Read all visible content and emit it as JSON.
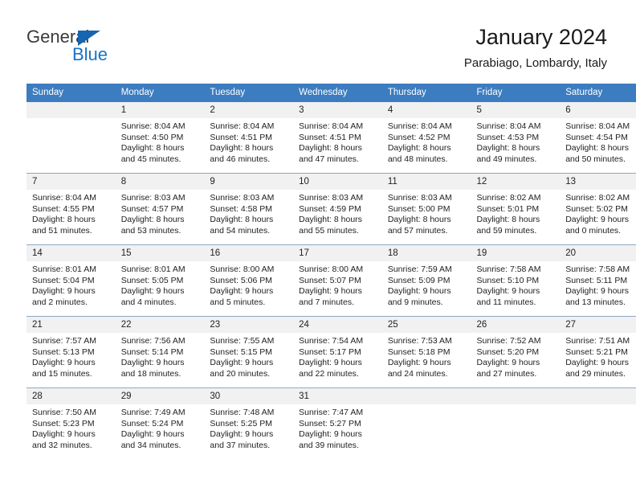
{
  "brand": {
    "name_part1": "General",
    "name_part2": "Blue",
    "color_dark": "#3b3b3b",
    "color_blue": "#1774c4"
  },
  "header": {
    "title": "January 2024",
    "subtitle": "Parabiago, Lombardy, Italy",
    "header_bg": "#3c7cc0"
  },
  "weekdays": [
    "Sunday",
    "Monday",
    "Tuesday",
    "Wednesday",
    "Thursday",
    "Friday",
    "Saturday"
  ],
  "weeks": [
    [
      {
        "day": "",
        "sunrise": "",
        "sunset": "",
        "daylight1": "",
        "daylight2": ""
      },
      {
        "day": "1",
        "sunrise": "Sunrise: 8:04 AM",
        "sunset": "Sunset: 4:50 PM",
        "daylight1": "Daylight: 8 hours",
        "daylight2": "and 45 minutes."
      },
      {
        "day": "2",
        "sunrise": "Sunrise: 8:04 AM",
        "sunset": "Sunset: 4:51 PM",
        "daylight1": "Daylight: 8 hours",
        "daylight2": "and 46 minutes."
      },
      {
        "day": "3",
        "sunrise": "Sunrise: 8:04 AM",
        "sunset": "Sunset: 4:51 PM",
        "daylight1": "Daylight: 8 hours",
        "daylight2": "and 47 minutes."
      },
      {
        "day": "4",
        "sunrise": "Sunrise: 8:04 AM",
        "sunset": "Sunset: 4:52 PM",
        "daylight1": "Daylight: 8 hours",
        "daylight2": "and 48 minutes."
      },
      {
        "day": "5",
        "sunrise": "Sunrise: 8:04 AM",
        "sunset": "Sunset: 4:53 PM",
        "daylight1": "Daylight: 8 hours",
        "daylight2": "and 49 minutes."
      },
      {
        "day": "6",
        "sunrise": "Sunrise: 8:04 AM",
        "sunset": "Sunset: 4:54 PM",
        "daylight1": "Daylight: 8 hours",
        "daylight2": "and 50 minutes."
      }
    ],
    [
      {
        "day": "7",
        "sunrise": "Sunrise: 8:04 AM",
        "sunset": "Sunset: 4:55 PM",
        "daylight1": "Daylight: 8 hours",
        "daylight2": "and 51 minutes."
      },
      {
        "day": "8",
        "sunrise": "Sunrise: 8:03 AM",
        "sunset": "Sunset: 4:57 PM",
        "daylight1": "Daylight: 8 hours",
        "daylight2": "and 53 minutes."
      },
      {
        "day": "9",
        "sunrise": "Sunrise: 8:03 AM",
        "sunset": "Sunset: 4:58 PM",
        "daylight1": "Daylight: 8 hours",
        "daylight2": "and 54 minutes."
      },
      {
        "day": "10",
        "sunrise": "Sunrise: 8:03 AM",
        "sunset": "Sunset: 4:59 PM",
        "daylight1": "Daylight: 8 hours",
        "daylight2": "and 55 minutes."
      },
      {
        "day": "11",
        "sunrise": "Sunrise: 8:03 AM",
        "sunset": "Sunset: 5:00 PM",
        "daylight1": "Daylight: 8 hours",
        "daylight2": "and 57 minutes."
      },
      {
        "day": "12",
        "sunrise": "Sunrise: 8:02 AM",
        "sunset": "Sunset: 5:01 PM",
        "daylight1": "Daylight: 8 hours",
        "daylight2": "and 59 minutes."
      },
      {
        "day": "13",
        "sunrise": "Sunrise: 8:02 AM",
        "sunset": "Sunset: 5:02 PM",
        "daylight1": "Daylight: 9 hours",
        "daylight2": "and 0 minutes."
      }
    ],
    [
      {
        "day": "14",
        "sunrise": "Sunrise: 8:01 AM",
        "sunset": "Sunset: 5:04 PM",
        "daylight1": "Daylight: 9 hours",
        "daylight2": "and 2 minutes."
      },
      {
        "day": "15",
        "sunrise": "Sunrise: 8:01 AM",
        "sunset": "Sunset: 5:05 PM",
        "daylight1": "Daylight: 9 hours",
        "daylight2": "and 4 minutes."
      },
      {
        "day": "16",
        "sunrise": "Sunrise: 8:00 AM",
        "sunset": "Sunset: 5:06 PM",
        "daylight1": "Daylight: 9 hours",
        "daylight2": "and 5 minutes."
      },
      {
        "day": "17",
        "sunrise": "Sunrise: 8:00 AM",
        "sunset": "Sunset: 5:07 PM",
        "daylight1": "Daylight: 9 hours",
        "daylight2": "and 7 minutes."
      },
      {
        "day": "18",
        "sunrise": "Sunrise: 7:59 AM",
        "sunset": "Sunset: 5:09 PM",
        "daylight1": "Daylight: 9 hours",
        "daylight2": "and 9 minutes."
      },
      {
        "day": "19",
        "sunrise": "Sunrise: 7:58 AM",
        "sunset": "Sunset: 5:10 PM",
        "daylight1": "Daylight: 9 hours",
        "daylight2": "and 11 minutes."
      },
      {
        "day": "20",
        "sunrise": "Sunrise: 7:58 AM",
        "sunset": "Sunset: 5:11 PM",
        "daylight1": "Daylight: 9 hours",
        "daylight2": "and 13 minutes."
      }
    ],
    [
      {
        "day": "21",
        "sunrise": "Sunrise: 7:57 AM",
        "sunset": "Sunset: 5:13 PM",
        "daylight1": "Daylight: 9 hours",
        "daylight2": "and 15 minutes."
      },
      {
        "day": "22",
        "sunrise": "Sunrise: 7:56 AM",
        "sunset": "Sunset: 5:14 PM",
        "daylight1": "Daylight: 9 hours",
        "daylight2": "and 18 minutes."
      },
      {
        "day": "23",
        "sunrise": "Sunrise: 7:55 AM",
        "sunset": "Sunset: 5:15 PM",
        "daylight1": "Daylight: 9 hours",
        "daylight2": "and 20 minutes."
      },
      {
        "day": "24",
        "sunrise": "Sunrise: 7:54 AM",
        "sunset": "Sunset: 5:17 PM",
        "daylight1": "Daylight: 9 hours",
        "daylight2": "and 22 minutes."
      },
      {
        "day": "25",
        "sunrise": "Sunrise: 7:53 AM",
        "sunset": "Sunset: 5:18 PM",
        "daylight1": "Daylight: 9 hours",
        "daylight2": "and 24 minutes."
      },
      {
        "day": "26",
        "sunrise": "Sunrise: 7:52 AM",
        "sunset": "Sunset: 5:20 PM",
        "daylight1": "Daylight: 9 hours",
        "daylight2": "and 27 minutes."
      },
      {
        "day": "27",
        "sunrise": "Sunrise: 7:51 AM",
        "sunset": "Sunset: 5:21 PM",
        "daylight1": "Daylight: 9 hours",
        "daylight2": "and 29 minutes."
      }
    ],
    [
      {
        "day": "28",
        "sunrise": "Sunrise: 7:50 AM",
        "sunset": "Sunset: 5:23 PM",
        "daylight1": "Daylight: 9 hours",
        "daylight2": "and 32 minutes."
      },
      {
        "day": "29",
        "sunrise": "Sunrise: 7:49 AM",
        "sunset": "Sunset: 5:24 PM",
        "daylight1": "Daylight: 9 hours",
        "daylight2": "and 34 minutes."
      },
      {
        "day": "30",
        "sunrise": "Sunrise: 7:48 AM",
        "sunset": "Sunset: 5:25 PM",
        "daylight1": "Daylight: 9 hours",
        "daylight2": "and 37 minutes."
      },
      {
        "day": "31",
        "sunrise": "Sunrise: 7:47 AM",
        "sunset": "Sunset: 5:27 PM",
        "daylight1": "Daylight: 9 hours",
        "daylight2": "and 39 minutes."
      },
      {
        "day": "",
        "sunrise": "",
        "sunset": "",
        "daylight1": "",
        "daylight2": ""
      },
      {
        "day": "",
        "sunrise": "",
        "sunset": "",
        "daylight1": "",
        "daylight2": ""
      },
      {
        "day": "",
        "sunrise": "",
        "sunset": "",
        "daylight1": "",
        "daylight2": ""
      }
    ]
  ]
}
